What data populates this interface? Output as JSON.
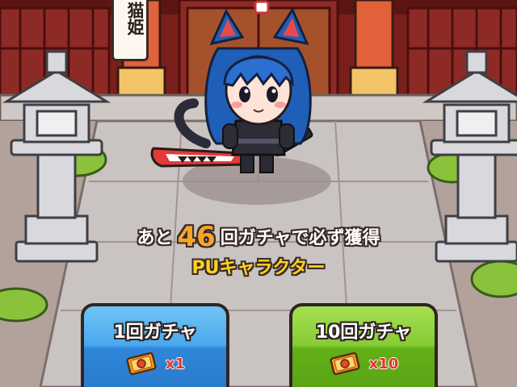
{
  "shrine": {
    "banner_text": "猫姫"
  },
  "character": {
    "name": "猫姫"
  },
  "pity": {
    "prefix": "あと",
    "count": "46",
    "suffix": "回ガチャで必ず獲得",
    "reward": "PUキャラクター"
  },
  "buttons": [
    {
      "label": "1回ガチャ",
      "cost": "x1",
      "color": "#3d9be6",
      "icon": "gacha-ticket-icon"
    },
    {
      "label": "10回ガチャ",
      "cost": "x10",
      "color": "#78c12a",
      "icon": "gacha-ticket-icon"
    }
  ]
}
